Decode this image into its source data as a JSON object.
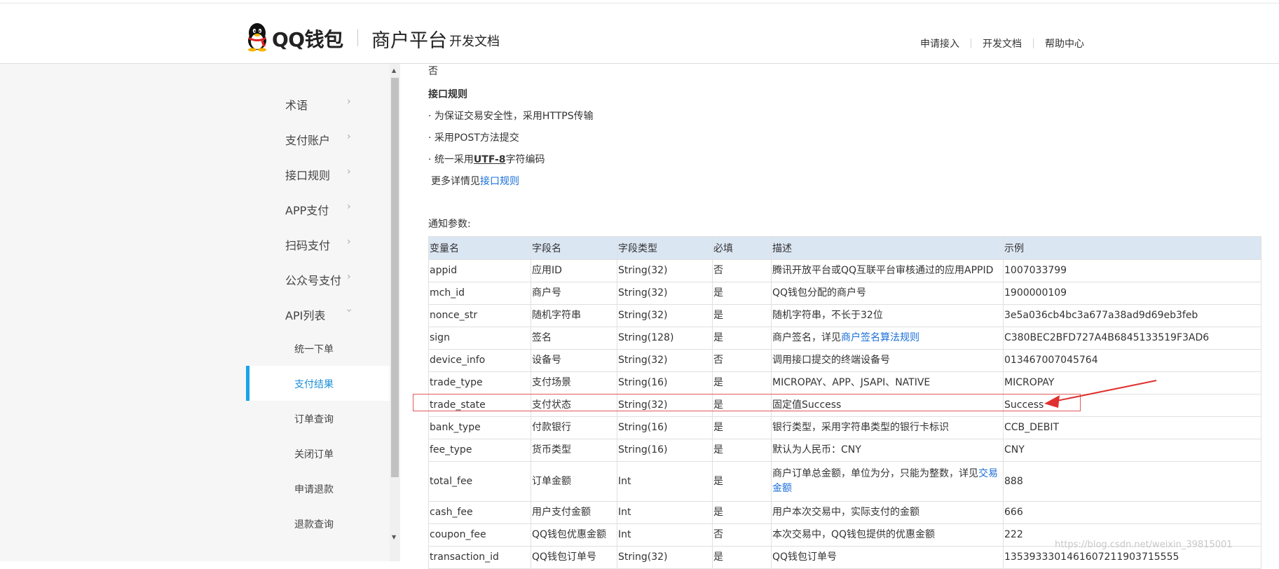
{
  "header": {
    "logo_text": "QQ钱包",
    "platform_title": "商户平台",
    "platform_sub": "开发文档",
    "nav": [
      "申请接入",
      "开发文档",
      "帮助中心"
    ]
  },
  "sidebar": {
    "items": [
      "术语",
      "支付账户",
      "接口规则",
      "APP支付",
      "扫码支付",
      "公众号支付",
      "API列表"
    ],
    "sub_items": [
      "统一下单",
      "支付结果",
      "订单查询",
      "关闭订单",
      "申请退款",
      "退款查询"
    ],
    "active_sub": "支付结果"
  },
  "content": {
    "partial_top": "否",
    "rules_title": "接口规则",
    "rule1": "· 为保证交易安全性，采用HTTPS传输",
    "rule2": "· 采用POST方法提交",
    "rule3_prefix": "· 统一采用",
    "rule3_bold": "UTF-8",
    "rule3_suffix": "字符编码",
    "more_prefix": "更多详情见",
    "more_link": "接口规则",
    "notify_title": "通知参数:"
  },
  "table": {
    "headers": [
      "变量名",
      "字段名",
      "字段类型",
      "必填",
      "描述",
      "示例"
    ],
    "rows": [
      {
        "var": "appid",
        "field": "应用ID",
        "type": "String(32)",
        "required": "否",
        "desc": "腾讯开放平台或QQ互联平台审核通过的应用APPID",
        "example": "1007033799"
      },
      {
        "var": "mch_id",
        "field": "商户号",
        "type": "String(32)",
        "required": "是",
        "desc": "QQ钱包分配的商户号",
        "example": "1900000109"
      },
      {
        "var": "nonce_str",
        "field": "随机字符串",
        "type": "String(32)",
        "required": "是",
        "desc": "随机字符串，不长于32位",
        "example": "3e5a036cb4bc3a677a38ad9d69eb3feb"
      },
      {
        "var": "sign",
        "field": "签名",
        "type": "String(128)",
        "required": "是",
        "desc_prefix": "商户签名，详见",
        "desc_link": "商户签名算法规则",
        "example": "C380BEC2BFD727A4B6845133519F3AD6"
      },
      {
        "var": "device_info",
        "field": "设备号",
        "type": "String(32)",
        "required": "否",
        "desc": "调用接口提交的终端设备号",
        "example": "013467007045764"
      },
      {
        "var": "trade_type",
        "field": "支付场景",
        "type": "String(16)",
        "required": "是",
        "desc": "MICROPAY、APP、JSAPI、NATIVE",
        "example": "MICROPAY"
      },
      {
        "var": "trade_state",
        "field": "支付状态",
        "type": "String(32)",
        "required": "是",
        "desc": "固定值Success",
        "example": "Success"
      },
      {
        "var": "bank_type",
        "field": "付款银行",
        "type": "String(16)",
        "required": "是",
        "desc": "银行类型，采用字符串类型的银行卡标识",
        "example": "CCB_DEBIT"
      },
      {
        "var": "fee_type",
        "field": "货币类型",
        "type": "String(16)",
        "required": "是",
        "desc": "默认为人民币：CNY",
        "example": "CNY"
      },
      {
        "var": "total_fee",
        "field": "订单金额",
        "type": "Int",
        "required": "是",
        "desc_prefix": "商户订单总金额，单位为分，只能为整数，详见",
        "desc_link": "交易金额",
        "example": "888"
      },
      {
        "var": "cash_fee",
        "field": "用户支付金额",
        "type": "Int",
        "required": "是",
        "desc": "用户本次交易中，实际支付的金额",
        "example": "666"
      },
      {
        "var": "coupon_fee",
        "field": "QQ钱包优惠金额",
        "type": "Int",
        "required": "否",
        "desc": "本次交易中，QQ钱包提供的优惠金额",
        "example": "222"
      },
      {
        "var": "transaction_id",
        "field": "QQ钱包订单号",
        "type": "String(32)",
        "required": "是",
        "desc": "QQ钱包订单号",
        "example": "1353933301461607211903715555"
      }
    ]
  },
  "watermark": "https://blog.csdn.net/weixin_39815001"
}
